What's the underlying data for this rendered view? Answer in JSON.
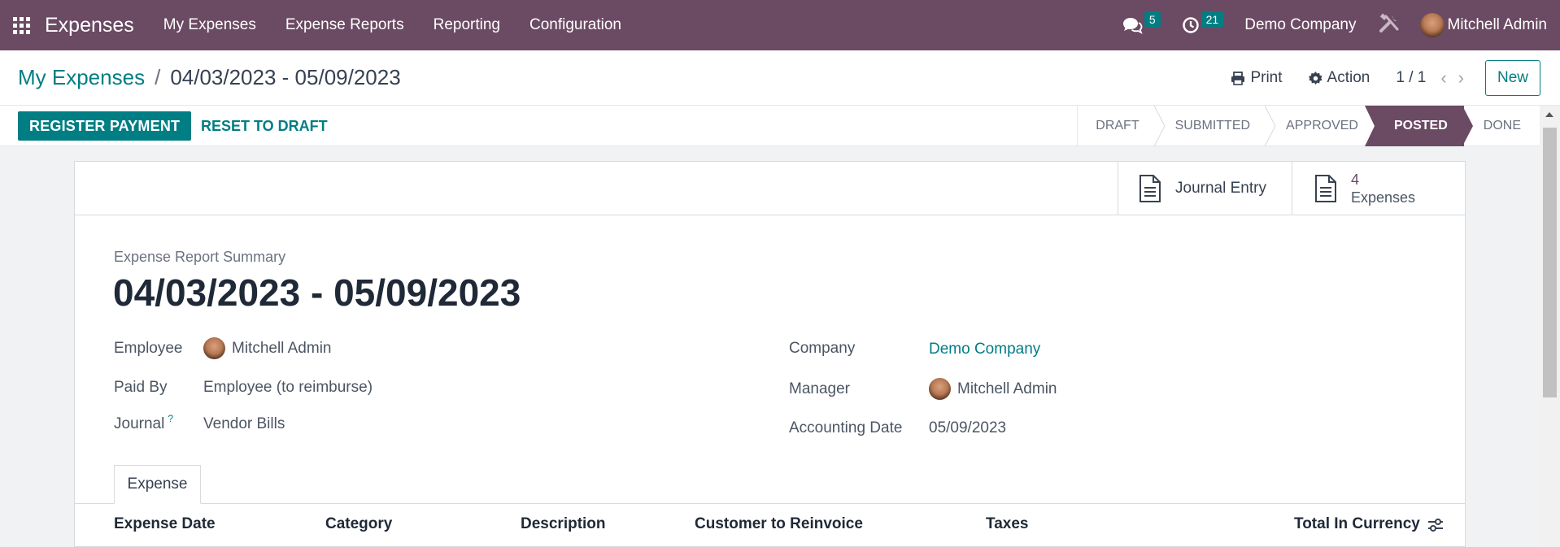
{
  "navbar": {
    "app_name": "Expenses",
    "menu": [
      "My Expenses",
      "Expense Reports",
      "Reporting",
      "Configuration"
    ],
    "messages_count": "5",
    "activities_count": "21",
    "company": "Demo Company",
    "user": "Mitchell Admin",
    "bg_color": "#6b4a63"
  },
  "breadcrumb": {
    "parent": "My Expenses",
    "separator": "/",
    "current": "04/03/2023 - 05/09/2023"
  },
  "control": {
    "print_label": "Print",
    "action_label": "Action",
    "pager": "1 / 1",
    "new_label": "New"
  },
  "status_bar": {
    "register_payment": "REGISTER PAYMENT",
    "reset_to_draft": "RESET TO DRAFT",
    "stages": [
      "DRAFT",
      "SUBMITTED",
      "APPROVED",
      "POSTED",
      "DONE"
    ],
    "active_stage": "POSTED"
  },
  "smart_buttons": {
    "journal_entry": "Journal Entry",
    "expenses_count": "4",
    "expenses_label": "Expenses"
  },
  "form": {
    "summary_label": "Expense Report Summary",
    "title": "04/03/2023 - 05/09/2023",
    "employee_label": "Employee",
    "employee_value": "Mitchell Admin",
    "paid_by_label": "Paid By",
    "paid_by_value": "Employee (to reimburse)",
    "journal_label": "Journal",
    "journal_help": "?",
    "journal_value": "Vendor Bills",
    "company_label": "Company",
    "company_value": "Demo Company",
    "manager_label": "Manager",
    "manager_value": "Mitchell Admin",
    "accounting_date_label": "Accounting Date",
    "accounting_date_value": "05/09/2023"
  },
  "tabs": [
    "Expense"
  ],
  "table": {
    "columns": [
      "Expense Date",
      "Category",
      "Description",
      "Customer to Reinvoice",
      "Taxes",
      "Total In Currency"
    ]
  },
  "colors": {
    "primary": "#017e84",
    "brand": "#6b4a63"
  }
}
